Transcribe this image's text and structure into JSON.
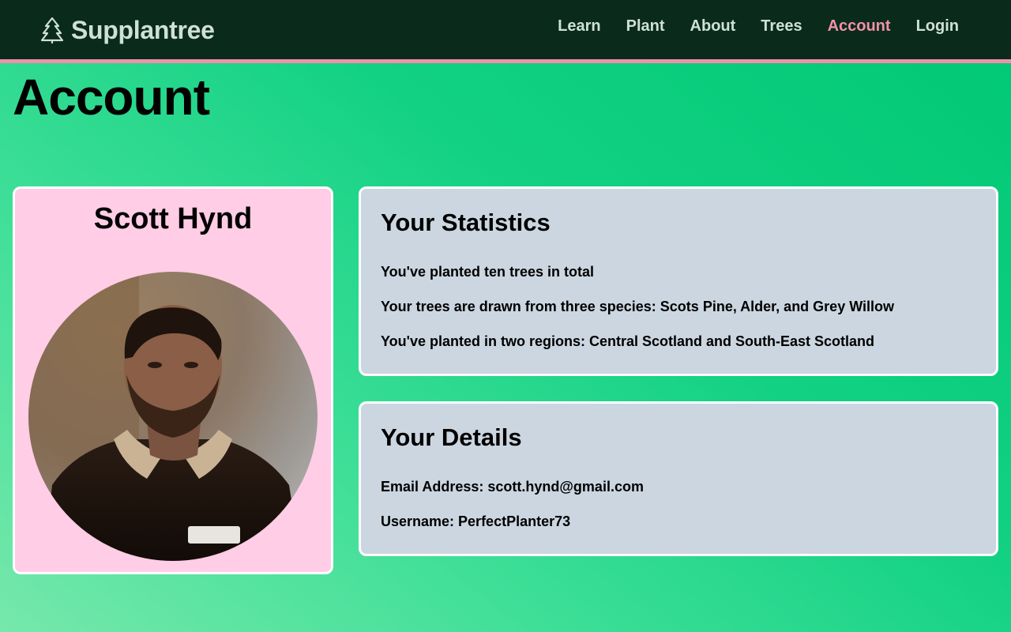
{
  "nav": {
    "brand": "Supplantree",
    "brand_icon": "tree-icon",
    "links": [
      {
        "label": "Learn",
        "active": false
      },
      {
        "label": "Plant",
        "active": false
      },
      {
        "label": "About",
        "active": false
      },
      {
        "label": "Trees",
        "active": false
      },
      {
        "label": "Account",
        "active": true
      },
      {
        "label": "Login",
        "active": false
      }
    ]
  },
  "page": {
    "title": "Account"
  },
  "profile": {
    "name": "Scott Hynd"
  },
  "statistics": {
    "heading": "Your Statistics",
    "lines": [
      "You've planted ten trees in total",
      "Your trees are drawn from three species: Scots Pine, Alder, and Grey Willow",
      "You've planted in two regions: Central Scotland and South-East Scotland"
    ]
  },
  "details": {
    "heading": "Your Details",
    "lines": [
      "Email Address: scott.hynd@gmail.com",
      "Username: PerfectPlanter73"
    ]
  },
  "colors": {
    "navbar_bg": "#0a2a1b",
    "nav_text": "#cfe0d6",
    "accent_pink": "#f191a8",
    "profile_card_bg": "#ffcde5",
    "panel_bg": "#cbd6e0",
    "page_green": "#00c874"
  }
}
